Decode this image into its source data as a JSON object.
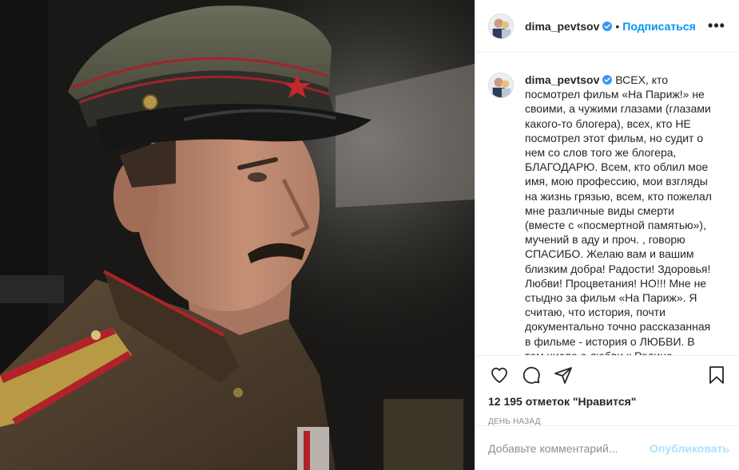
{
  "post": {
    "username": "dima_pevtsov",
    "verified": true,
    "follow_label": "Подписаться",
    "separator": "•",
    "more_label": "•••"
  },
  "caption": {
    "username": "dima_pevtsov",
    "text": "ВСЕХ, кто посмотрел фильм «На Париж!» не своими, а чужими глазами (глазами какого-то блогера), всех, кто НЕ посмотрел этот фильм, но судит о нем со слов того же блогера, БЛАГОДАРЮ. Всем, кто облил мое имя, мою профессию, мои взгляды на жизнь грязью, всем, кто пожелал мне различные виды смерти (вместе с «посмертной памятью»), мучений в аду и проч. , говорю СПАСИБО. Желаю вам и вашим близким добра! Радости! Здоровья! Любви! Процветания! НО!!! Мне не стыдно за фильм «На Париж». Я считаю, что история, почти документально точно рассказанная в фильме - история о ЛЮБВИ. В том числе о любви к Родине..."
  },
  "stats": {
    "likes_text": "12 195 отметок \"Нравится\"",
    "time_text": "ДЕНЬ НАЗАД"
  },
  "comment_box": {
    "placeholder": "Добавьте комментарий...",
    "publish_label": "Опубликовать"
  },
  "icons": {
    "like": "heart-icon",
    "comment": "comment-icon",
    "share": "share-icon",
    "save": "bookmark-icon",
    "verified": "verified-badge-icon"
  },
  "colors": {
    "accent": "#0095f6",
    "publish_disabled": "#b2dffc",
    "muted": "#8e8e8e",
    "text": "#262626"
  }
}
